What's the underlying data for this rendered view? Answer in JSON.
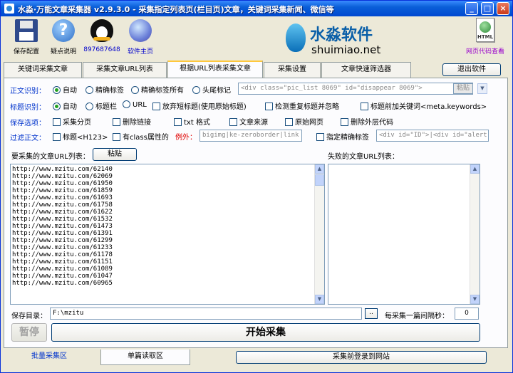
{
  "window": {
    "title": "水淼·万能文章采集器 v2.9.3.0 - 采集指定列表页(栏目页)文章，关键词采集新闻、微信等",
    "min": "_",
    "max": "□",
    "close": "×"
  },
  "toolbar": {
    "save_config": "保存配置",
    "help": "疑点说明",
    "qq": "897687648",
    "homepage": "软件主页",
    "logo_cn": "水淼软件",
    "logo_en": "shuimiao.net",
    "html_badge": "HTML",
    "view_source": "网页代码查看"
  },
  "tabs": [
    "关键词采集文章",
    "采集文章URL列表",
    "根据URL列表采集文章",
    "采集设置",
    "文章快速筛选器"
  ],
  "exit_button": "退出软件",
  "body_recognition": {
    "label": "正文识别：",
    "options": [
      "自动",
      "精确标签",
      "精确标签所有",
      "头尾标记"
    ],
    "value": "<div class=\"pic_list 8069\" id=\"disappear 8069\">",
    "paste": "粘贴"
  },
  "title_recognition": {
    "label": "标题识别：",
    "options": [
      "自动",
      "标题栏",
      "URL"
    ],
    "checks": [
      "放弃短标题(使用原始标题)",
      "检测重复标题并忽略",
      "标题前加关键词<meta.keywords>"
    ]
  },
  "save_options": {
    "label": "保存选项：",
    "checks": [
      "采集分页",
      "删除链接",
      "txt 格式",
      "文章来源",
      "原始网页",
      "删除外层代码"
    ]
  },
  "filter_body": {
    "label": "过滤正文：",
    "check1": "标题<H123>",
    "check2": "有class属性的",
    "exception": "例外：",
    "exception_value": "bigimg|ke-zeroborder|link",
    "check3": "指定精确标签",
    "tag_value": "<div id=\"ID\">|<div id=\"alert"
  },
  "url_list": {
    "label": "要采集的文章URL列表：",
    "paste": "粘贴",
    "items": [
      "http://www.mzitu.com/62140",
      "http://www.mzitu.com/62069",
      "http://www.mzitu.com/61950",
      "http://www.mzitu.com/61859",
      "http://www.mzitu.com/61693",
      "http://www.mzitu.com/61758",
      "http://www.mzitu.com/61622",
      "http://www.mzitu.com/61532",
      "http://www.mzitu.com/61473",
      "http://www.mzitu.com/61391",
      "http://www.mzitu.com/61299",
      "http://www.mzitu.com/61233",
      "http://www.mzitu.com/61178",
      "http://www.mzitu.com/61151",
      "http://www.mzitu.com/61089",
      "http://www.mzitu.com/61047",
      "http://www.mzitu.com/60965"
    ]
  },
  "failed_list": {
    "label": "失败的文章URL列表："
  },
  "save_dir": {
    "label": "保存目录：",
    "value": "F:\\mzitu",
    "browse": "..",
    "interval_label": "每采集一篇间隔秒：",
    "interval": "0"
  },
  "actions": {
    "pause": "暂停",
    "start": "开始采集"
  },
  "bottom": {
    "batch": "批量采集区",
    "single": "单篇读取区",
    "login": "采集前登录到网站"
  }
}
